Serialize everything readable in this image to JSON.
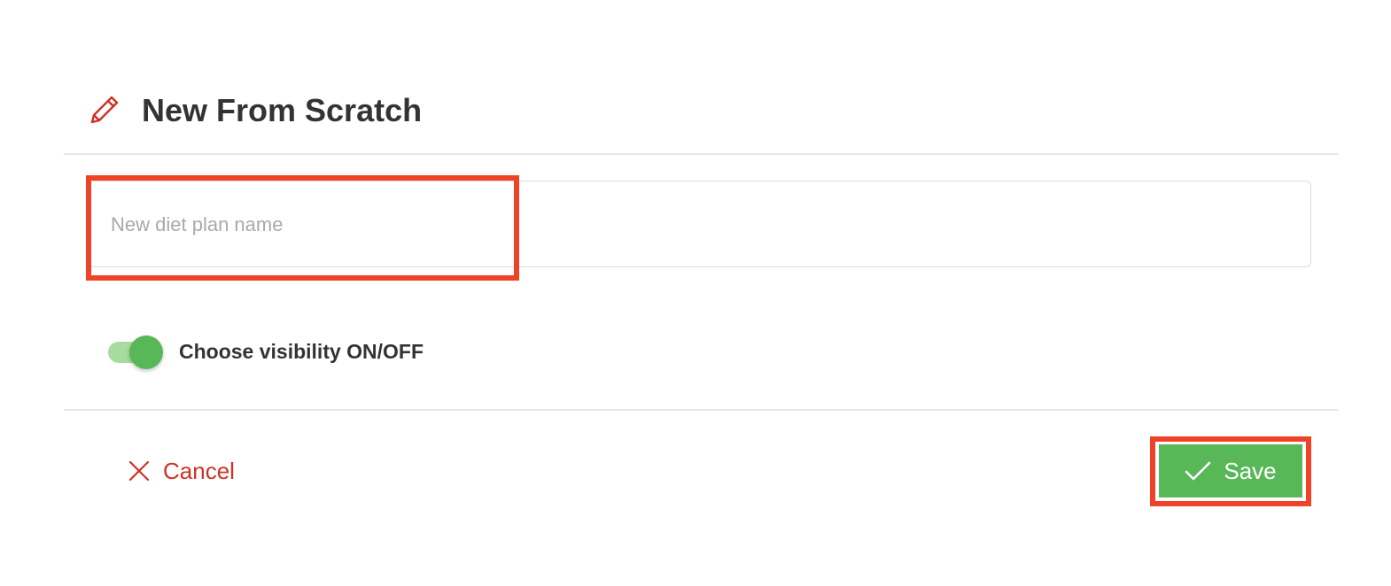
{
  "dialog": {
    "title": "New From Scratch",
    "title_icon": "pencil-icon",
    "name_input": {
      "value": "",
      "placeholder": "New diet plan name"
    },
    "visibility_toggle": {
      "label": "Choose visibility ON/OFF",
      "state": "on"
    },
    "footer": {
      "cancel_label": "Cancel",
      "cancel_icon": "close-icon",
      "save_label": "Save",
      "save_icon": "check-icon"
    }
  },
  "colors": {
    "accent_green": "#58b857",
    "toggle_track": "#a8dba0",
    "cancel_red": "#cf3125",
    "highlight_red": "#ef4328",
    "title_text": "#333333"
  }
}
